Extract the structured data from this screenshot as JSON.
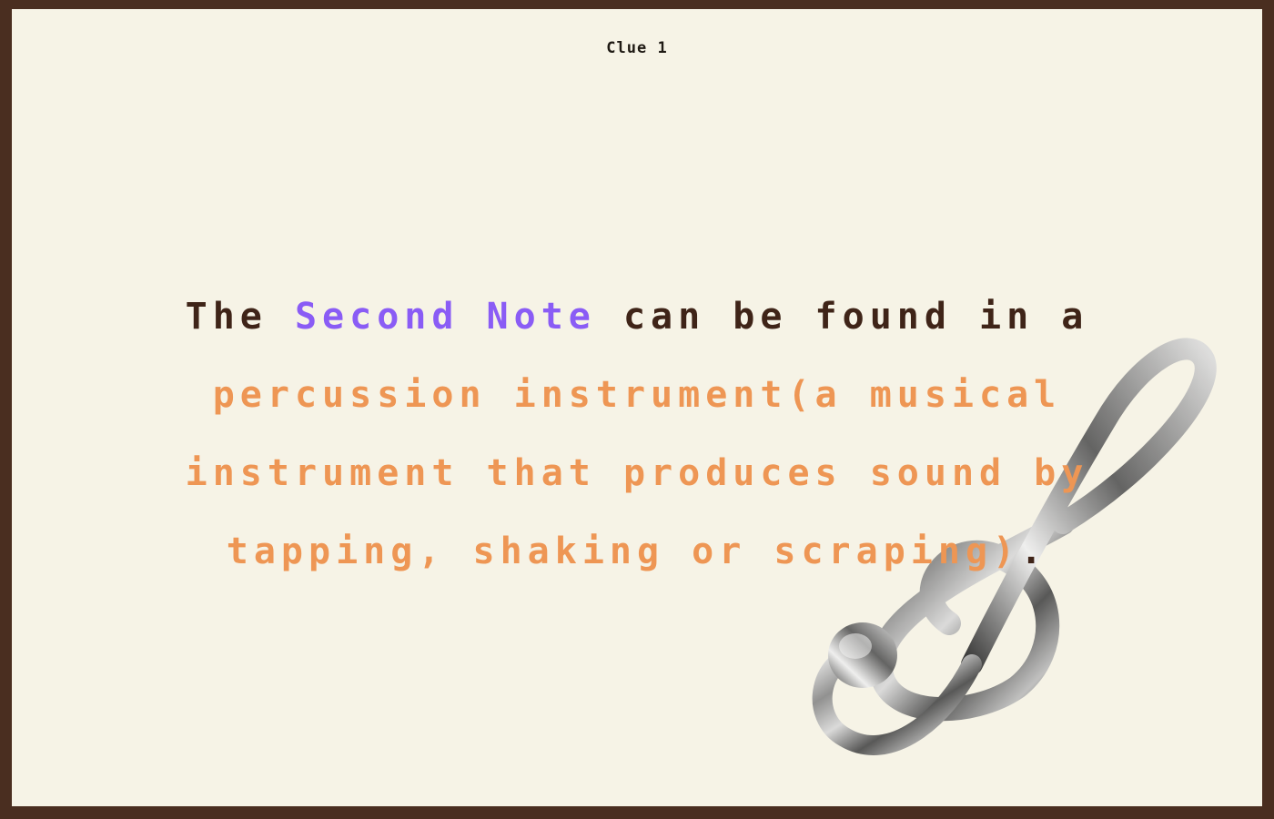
{
  "clue": {
    "title": "Clue 1",
    "text_intro": "The",
    "text_highlight": "Second Note",
    "text_middle": "can be found in a",
    "text_answer": "percussion instrument(a musical instrument that produces sound by tapping, shaking or scraping)",
    "text_end": "."
  },
  "decoration": {
    "icon": "treble-clef-icon"
  },
  "colors": {
    "border": "#4a2e20",
    "background": "#f6f3e6",
    "text_dark": "#3f2418",
    "highlight_purple": "#8a5cf5",
    "answer_orange": "#ee9654"
  }
}
